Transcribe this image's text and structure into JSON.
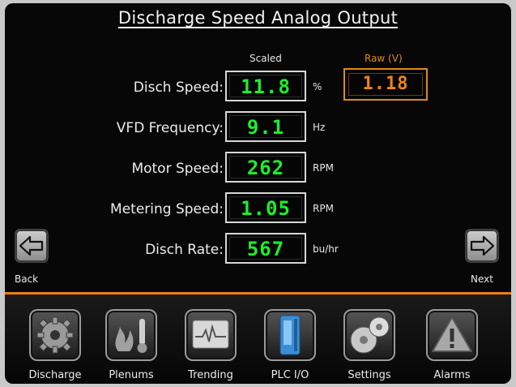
{
  "header": {
    "title": "Discharge Speed Analog Output"
  },
  "columns": {
    "scaled": "Scaled",
    "raw": "Raw (V)"
  },
  "rows": [
    {
      "label": "Disch Speed:",
      "value": "11.8",
      "unit": "%"
    },
    {
      "label": "VFD Frequency:",
      "value": "9.1",
      "unit": "Hz"
    },
    {
      "label": "Motor Speed:",
      "value": "262",
      "unit": "RPM"
    },
    {
      "label": "Metering Speed:",
      "value": "1.05",
      "unit": "RPM"
    },
    {
      "label": "Disch Rate:",
      "value": "567",
      "unit": "bu/hr"
    }
  ],
  "raw": {
    "value": "1.18"
  },
  "nav": {
    "back": "Back",
    "next": "Next"
  },
  "bottom_nav": [
    {
      "label": "Discharge",
      "icon": "gear-icon"
    },
    {
      "label": "Plenums",
      "icon": "flame-thermometer-icon"
    },
    {
      "label": "Trending",
      "icon": "trend-monitor-icon"
    },
    {
      "label": "PLC I/O",
      "icon": "plc-module-icon"
    },
    {
      "label": "Settings",
      "icon": "settings-knobs-icon"
    },
    {
      "label": "Alarms",
      "icon": "warning-icon"
    }
  ],
  "colors": {
    "accent": "#ef7e12",
    "value_green": "#1bf029",
    "raw_orange": "#f08410"
  }
}
